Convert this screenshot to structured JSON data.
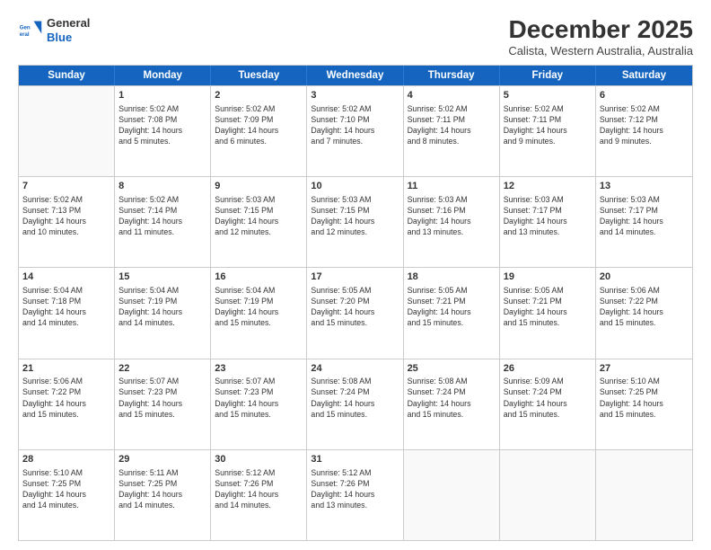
{
  "header": {
    "logo": {
      "general": "General",
      "blue": "Blue"
    },
    "title": "December 2025",
    "subtitle": "Calista, Western Australia, Australia"
  },
  "days": [
    "Sunday",
    "Monday",
    "Tuesday",
    "Wednesday",
    "Thursday",
    "Friday",
    "Saturday"
  ],
  "rows": [
    [
      {
        "day": "",
        "content": ""
      },
      {
        "day": "1",
        "content": "Sunrise: 5:02 AM\nSunset: 7:08 PM\nDaylight: 14 hours\nand 5 minutes."
      },
      {
        "day": "2",
        "content": "Sunrise: 5:02 AM\nSunset: 7:09 PM\nDaylight: 14 hours\nand 6 minutes."
      },
      {
        "day": "3",
        "content": "Sunrise: 5:02 AM\nSunset: 7:10 PM\nDaylight: 14 hours\nand 7 minutes."
      },
      {
        "day": "4",
        "content": "Sunrise: 5:02 AM\nSunset: 7:11 PM\nDaylight: 14 hours\nand 8 minutes."
      },
      {
        "day": "5",
        "content": "Sunrise: 5:02 AM\nSunset: 7:11 PM\nDaylight: 14 hours\nand 9 minutes."
      },
      {
        "day": "6",
        "content": "Sunrise: 5:02 AM\nSunset: 7:12 PM\nDaylight: 14 hours\nand 9 minutes."
      }
    ],
    [
      {
        "day": "7",
        "content": "Sunrise: 5:02 AM\nSunset: 7:13 PM\nDaylight: 14 hours\nand 10 minutes."
      },
      {
        "day": "8",
        "content": "Sunrise: 5:02 AM\nSunset: 7:14 PM\nDaylight: 14 hours\nand 11 minutes."
      },
      {
        "day": "9",
        "content": "Sunrise: 5:03 AM\nSunset: 7:15 PM\nDaylight: 14 hours\nand 12 minutes."
      },
      {
        "day": "10",
        "content": "Sunrise: 5:03 AM\nSunset: 7:15 PM\nDaylight: 14 hours\nand 12 minutes."
      },
      {
        "day": "11",
        "content": "Sunrise: 5:03 AM\nSunset: 7:16 PM\nDaylight: 14 hours\nand 13 minutes."
      },
      {
        "day": "12",
        "content": "Sunrise: 5:03 AM\nSunset: 7:17 PM\nDaylight: 14 hours\nand 13 minutes."
      },
      {
        "day": "13",
        "content": "Sunrise: 5:03 AM\nSunset: 7:17 PM\nDaylight: 14 hours\nand 14 minutes."
      }
    ],
    [
      {
        "day": "14",
        "content": "Sunrise: 5:04 AM\nSunset: 7:18 PM\nDaylight: 14 hours\nand 14 minutes."
      },
      {
        "day": "15",
        "content": "Sunrise: 5:04 AM\nSunset: 7:19 PM\nDaylight: 14 hours\nand 14 minutes."
      },
      {
        "day": "16",
        "content": "Sunrise: 5:04 AM\nSunset: 7:19 PM\nDaylight: 14 hours\nand 15 minutes."
      },
      {
        "day": "17",
        "content": "Sunrise: 5:05 AM\nSunset: 7:20 PM\nDaylight: 14 hours\nand 15 minutes."
      },
      {
        "day": "18",
        "content": "Sunrise: 5:05 AM\nSunset: 7:21 PM\nDaylight: 14 hours\nand 15 minutes."
      },
      {
        "day": "19",
        "content": "Sunrise: 5:05 AM\nSunset: 7:21 PM\nDaylight: 14 hours\nand 15 minutes."
      },
      {
        "day": "20",
        "content": "Sunrise: 5:06 AM\nSunset: 7:22 PM\nDaylight: 14 hours\nand 15 minutes."
      }
    ],
    [
      {
        "day": "21",
        "content": "Sunrise: 5:06 AM\nSunset: 7:22 PM\nDaylight: 14 hours\nand 15 minutes."
      },
      {
        "day": "22",
        "content": "Sunrise: 5:07 AM\nSunset: 7:23 PM\nDaylight: 14 hours\nand 15 minutes."
      },
      {
        "day": "23",
        "content": "Sunrise: 5:07 AM\nSunset: 7:23 PM\nDaylight: 14 hours\nand 15 minutes."
      },
      {
        "day": "24",
        "content": "Sunrise: 5:08 AM\nSunset: 7:24 PM\nDaylight: 14 hours\nand 15 minutes."
      },
      {
        "day": "25",
        "content": "Sunrise: 5:08 AM\nSunset: 7:24 PM\nDaylight: 14 hours\nand 15 minutes."
      },
      {
        "day": "26",
        "content": "Sunrise: 5:09 AM\nSunset: 7:24 PM\nDaylight: 14 hours\nand 15 minutes."
      },
      {
        "day": "27",
        "content": "Sunrise: 5:10 AM\nSunset: 7:25 PM\nDaylight: 14 hours\nand 15 minutes."
      }
    ],
    [
      {
        "day": "28",
        "content": "Sunrise: 5:10 AM\nSunset: 7:25 PM\nDaylight: 14 hours\nand 14 minutes."
      },
      {
        "day": "29",
        "content": "Sunrise: 5:11 AM\nSunset: 7:25 PM\nDaylight: 14 hours\nand 14 minutes."
      },
      {
        "day": "30",
        "content": "Sunrise: 5:12 AM\nSunset: 7:26 PM\nDaylight: 14 hours\nand 14 minutes."
      },
      {
        "day": "31",
        "content": "Sunrise: 5:12 AM\nSunset: 7:26 PM\nDaylight: 14 hours\nand 13 minutes."
      },
      {
        "day": "",
        "content": ""
      },
      {
        "day": "",
        "content": ""
      },
      {
        "day": "",
        "content": ""
      }
    ]
  ]
}
